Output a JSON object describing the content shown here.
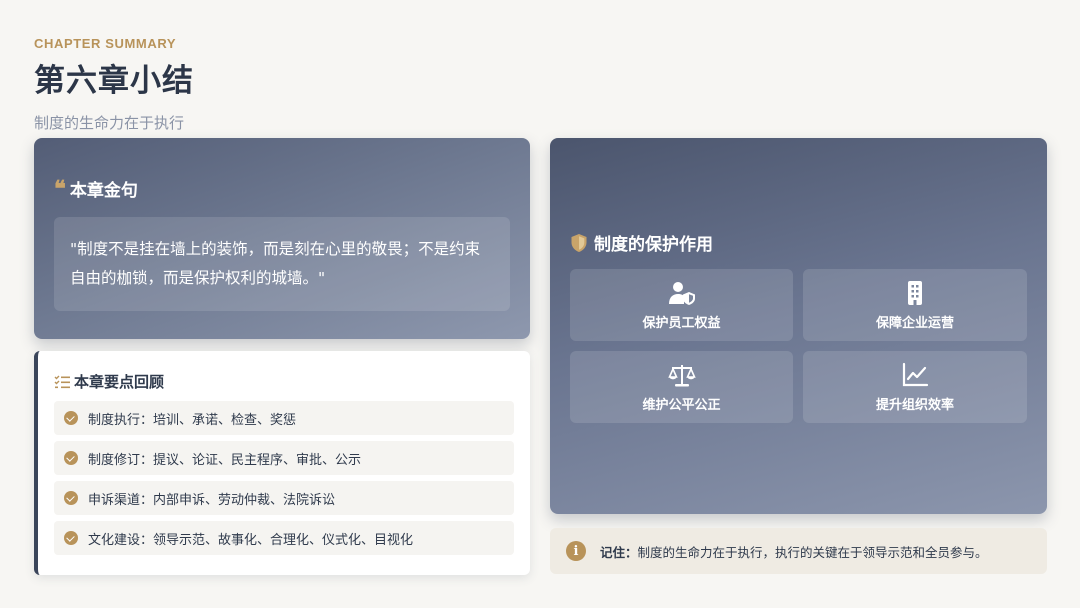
{
  "header": {
    "kicker": "CHAPTER SUMMARY",
    "title": "第六章小结",
    "subtitle": "制度的生命力在于执行"
  },
  "quote_card": {
    "icon": "quote-icon",
    "title": "本章金句",
    "quote": "\"制度不是挂在墙上的装饰，而是刻在心里的敬畏；不是约束自由的枷锁，而是保护权利的城墙。\""
  },
  "points_card": {
    "icon": "list-check-icon",
    "title": "本章要点回顾",
    "items": [
      {
        "label": "制度执行：培训、承诺、检查、奖惩"
      },
      {
        "label": "制度修订：提议、论证、民主程序、审批、公示"
      },
      {
        "label": "申诉渠道：内部申诉、劳动仲裁、法院诉讼"
      },
      {
        "label": "文化建设：领导示范、故事化、合理化、仪式化、目视化"
      }
    ]
  },
  "protect_card": {
    "icon": "shield-icon",
    "title": "制度的保护作用",
    "tiles": [
      {
        "label": "保护员工权益",
        "icon": "user-shield-icon"
      },
      {
        "label": "保障企业运营",
        "icon": "building-icon"
      },
      {
        "label": "维护公平公正",
        "icon": "balance-scale-icon"
      },
      {
        "label": "提升组织效率",
        "icon": "chart-line-icon"
      }
    ]
  },
  "note": {
    "icon": "info-icon",
    "label": "记住：",
    "text": "制度的生命力在于执行，执行的关键在于领导示范和全员参与。"
  },
  "colors": {
    "accent_gold": "#b8935a",
    "card_slate": "#6a7590",
    "title_dark": "#2c3648"
  }
}
